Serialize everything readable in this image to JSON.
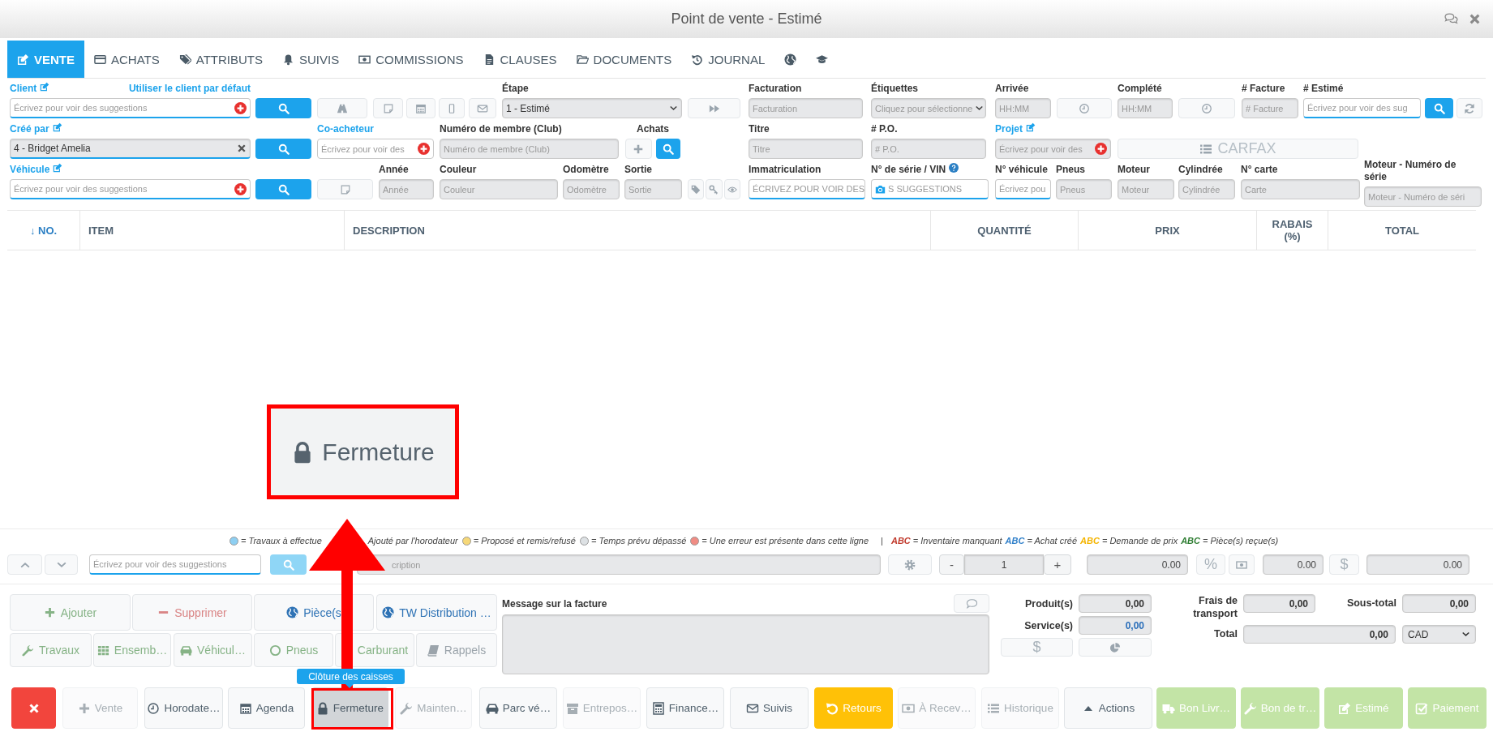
{
  "window": {
    "title": "Point de vente - Estimé"
  },
  "tabs": [
    {
      "label": "VENTE",
      "selected": true
    },
    {
      "label": "ACHATS",
      "selected": false
    },
    {
      "label": "ATTRIBUTS",
      "selected": false
    },
    {
      "label": "SUIVIS",
      "selected": false
    },
    {
      "label": "COMMISSIONS",
      "selected": false
    },
    {
      "label": "CLAUSES",
      "selected": false
    },
    {
      "label": "DOCUMENTS",
      "selected": false
    },
    {
      "label": "JOURNAL",
      "selected": false
    }
  ],
  "form": {
    "fields": [
      {
        "kind": "input",
        "label": "Client",
        "label_link": true,
        "edit_icon": true,
        "link": "Utiliser le client par défaut",
        "placeholder": "Écrivez pour voir des suggestions",
        "add_button": true,
        "active": true,
        "disabled": false
      },
      {
        "kind": "search"
      },
      {
        "kind": "icon"
      },
      {
        "kind": "icon"
      },
      {
        "kind": "icon"
      },
      {
        "kind": "icon"
      },
      {
        "kind": "icon"
      },
      {
        "kind": "select",
        "label": "Étape",
        "value": "1 - Estimé"
      },
      {
        "kind": "icon"
      },
      {
        "kind": "input",
        "label": "Facturation",
        "placeholder": "Facturation",
        "active": false,
        "disabled": true
      },
      {
        "kind": "select",
        "label": "Étiquettes",
        "placeholder": "Cliquez pour sélectionne"
      },
      {
        "kind": "input",
        "label": "Arrivée",
        "placeholder": "HH:MM",
        "active": false,
        "disabled": true
      },
      {
        "kind": "icon"
      },
      {
        "kind": "input",
        "label": "Complété",
        "placeholder": "HH:MM",
        "active": false,
        "disabled": true
      },
      {
        "kind": "icon"
      },
      {
        "kind": "input",
        "label": "# Facture",
        "placeholder": "# Facture",
        "active": false,
        "disabled": true
      },
      {
        "kind": "input",
        "label": "# Estimé",
        "placeholder": "Écrivez pour voir des sug",
        "active": true,
        "disabled": false
      },
      {
        "kind": "search"
      },
      {
        "kind": "icon"
      },
      {
        "kind": "input",
        "label": "Créé par",
        "label_link": true,
        "edit_icon": true,
        "value": "4 - Bridget Amelia",
        "clear_button": true,
        "active": true,
        "disabled": true
      },
      {
        "kind": "search"
      },
      {
        "kind": "input",
        "label": "Co-acheteur",
        "label_link": true,
        "placeholder": "Écrivez pour voir des",
        "add_button": true,
        "active": false,
        "disabled": false
      },
      {
        "kind": "input",
        "label": "Numéro de membre (Club)",
        "placeholder": "Numéro de membre (Club)",
        "active": false,
        "disabled": true
      },
      {
        "kind": "button-pair",
        "label": "Achats"
      },
      {
        "kind": "input",
        "label": "Titre",
        "placeholder": "Titre",
        "active": false,
        "disabled": true
      },
      {
        "kind": "input",
        "label": "# P.O.",
        "placeholder": "# P.O.",
        "active": false,
        "disabled": true
      },
      {
        "kind": "input",
        "label": "Projet",
        "label_link": true,
        "edit_icon": true,
        "placeholder": "Écrivez pour voir des",
        "add_button": true,
        "active": false,
        "disabled": true
      },
      {
        "kind": "wide-button",
        "label": "CARFAX",
        "disabled": true
      },
      {
        "kind": "input",
        "label": "Véhicule",
        "label_link": true,
        "edit_icon": true,
        "placeholder": "Écrivez pour voir des suggestions",
        "add_button": true,
        "active": true,
        "disabled": false
      },
      {
        "kind": "search"
      },
      {
        "kind": "icon"
      },
      {
        "kind": "input",
        "label": "Année",
        "placeholder": "Année",
        "active": false,
        "disabled": true
      },
      {
        "kind": "input",
        "label": "Couleur",
        "placeholder": "Couleur",
        "active": false,
        "disabled": true
      },
      {
        "kind": "input",
        "label": "Odomètre",
        "placeholder": "Odomètre",
        "active": false,
        "disabled": true
      },
      {
        "kind": "input",
        "label": "Sortie",
        "placeholder": "Sortie",
        "active": false,
        "disabled": true
      },
      {
        "kind": "icon-group"
      },
      {
        "kind": "input",
        "label": "Immatriculation",
        "placeholder": "ÉCRIVEZ POUR VOIR DES",
        "active": true,
        "disabled": false
      },
      {
        "kind": "input",
        "label": "N° de série / VIN",
        "help_icon": true,
        "placeholder": "S SUGGESTIONS",
        "scan_button": true,
        "active": true,
        "disabled": false
      },
      {
        "kind": "input",
        "label": "N° véhicule",
        "placeholder": "Écrivez pou",
        "active": true,
        "disabled": false
      },
      {
        "kind": "input",
        "label": "Pneus",
        "placeholder": "Pneus",
        "active": false,
        "disabled": true
      },
      {
        "kind": "input",
        "label": "Moteur",
        "placeholder": "Moteur",
        "active": false,
        "disabled": true
      },
      {
        "kind": "input",
        "label": "Cylindrée",
        "placeholder": "Cylindrée",
        "active": false,
        "disabled": true
      },
      {
        "kind": "input",
        "label": "N° carte",
        "placeholder": "Carte",
        "active": false,
        "disabled": true
      },
      {
        "kind": "input",
        "label": "Moteur - Numéro de série",
        "placeholder": "Moteur - Numéro de séri",
        "active": false,
        "disabled": true
      }
    ]
  },
  "table": {
    "columns": [
      {
        "label": "↓ NO.",
        "sorted": true
      },
      {
        "label": "ITEM",
        "sorted": false
      },
      {
        "label": "DESCRIPTION",
        "sorted": false
      },
      {
        "label": "QUANTITÉ",
        "sorted": false
      },
      {
        "label": "PRIX",
        "sorted": false
      },
      {
        "label": "RABAIS (%)",
        "sorted": false
      },
      {
        "label": "TOTAL",
        "sorted": false
      }
    ]
  },
  "legend": {
    "items": [
      {
        "color": "#8ecff2",
        "text": "= Travaux à effectue"
      },
      {
        "text": "Ajouté par l'horodateur"
      },
      {
        "color": "#f6d878",
        "text": "= Proposé et remis/refusé"
      },
      {
        "color": "#dde1e4",
        "text": "= Temps prévu dépassé"
      },
      {
        "color": "#f08c84",
        "text": "= Une erreur est présente dans cette ligne"
      }
    ],
    "separator": "|",
    "codes": [
      {
        "abc": "ABC",
        "color": "#c0392b",
        "text": "= Inventaire manquant"
      },
      {
        "abc": "ABC",
        "color": "#2f7fc9",
        "text": "= Achat créé"
      },
      {
        "abc": "ABC",
        "color": "#f4b400",
        "text": "= Demande de prix"
      },
      {
        "abc": "ABC",
        "color": "#2e7d32",
        "text": "= Pièce(s) reçue(s)"
      }
    ]
  },
  "line_entry": {
    "search_placeholder": "Écrivez pour voir des suggestions",
    "description_placeholder": "cription",
    "minus": "-",
    "quantity": "1",
    "plus": "+",
    "price": "0.00",
    "percent": "%",
    "discount": "0.00",
    "dollar": "$",
    "total": "0.00"
  },
  "actions": [
    [
      {
        "label": "Ajouter",
        "kind": "success"
      },
      {
        "label": "Supprimer",
        "kind": "danger"
      },
      {
        "label": "Pièce(s",
        "kind": "primary"
      },
      {
        "label": "TW Distribution …",
        "kind": "primary"
      }
    ],
    [
      {
        "label": "Travaux",
        "kind": "success"
      },
      {
        "label": "Ensemb…",
        "kind": "success"
      },
      {
        "label": "Véhicul…",
        "kind": "success"
      },
      {
        "label": "Pneus",
        "kind": "success"
      },
      {
        "label": "Carburant",
        "kind": "success"
      },
      {
        "label": "Rappels",
        "kind": "muted"
      }
    ]
  ],
  "message": {
    "label": "Message sur la facture"
  },
  "totals": {
    "products": {
      "label": "Produit(s)",
      "value": "0,00"
    },
    "services": {
      "label": "Service(s)",
      "value": "0,00"
    },
    "dollar": "$",
    "shipping": {
      "label": "Frais de transport",
      "value": "0,00"
    },
    "subtotal": {
      "label": "Sous-total",
      "value": "0,00"
    },
    "total": {
      "label": "Total",
      "value": "0,00"
    },
    "currency": "CAD"
  },
  "toolbar": [
    {
      "kind": "danger",
      "disabled": false,
      "highlighted": false
    },
    {
      "label": "Vente",
      "kind": "default",
      "disabled": true,
      "highlighted": false
    },
    {
      "label": "Horodate…",
      "kind": "default",
      "disabled": false,
      "highlighted": false
    },
    {
      "label": "Agenda",
      "kind": "default",
      "disabled": false,
      "highlighted": false
    },
    {
      "label": "Fermeture",
      "kind": "default",
      "disabled": false,
      "highlighted": true
    },
    {
      "label": "Mainten…",
      "kind": "default",
      "disabled": true,
      "highlighted": false
    },
    {
      "label": "Parc vé…",
      "kind": "default",
      "disabled": false,
      "highlighted": false
    },
    {
      "label": "Entrepos…",
      "kind": "default",
      "disabled": true,
      "highlighted": false
    },
    {
      "label": "Finance…",
      "kind": "default",
      "disabled": false,
      "highlighted": false
    },
    {
      "label": "Suivis",
      "kind": "default",
      "disabled": false,
      "highlighted": false
    },
    {
      "label": "Retours",
      "kind": "warning",
      "disabled": false,
      "highlighted": false
    },
    {
      "label": "À Recev…",
      "kind": "default",
      "disabled": true,
      "highlighted": false
    },
    {
      "label": "Historique",
      "kind": "default",
      "disabled": true,
      "highlighted": false
    },
    {
      "label": "Actions",
      "kind": "default",
      "disabled": false,
      "highlighted": false
    },
    {
      "label": "Bon Livr…",
      "kind": "success",
      "disabled": false,
      "highlighted": false
    },
    {
      "label": "Bon de tr…",
      "kind": "success",
      "disabled": false,
      "highlighted": false
    },
    {
      "label": "Estimé",
      "kind": "success",
      "disabled": false,
      "highlighted": false
    },
    {
      "label": "Paiement",
      "kind": "success",
      "disabled": false,
      "highlighted": false
    }
  ],
  "annotation": {
    "callout": "Fermeture",
    "tooltip": "Clôture des caisses"
  }
}
